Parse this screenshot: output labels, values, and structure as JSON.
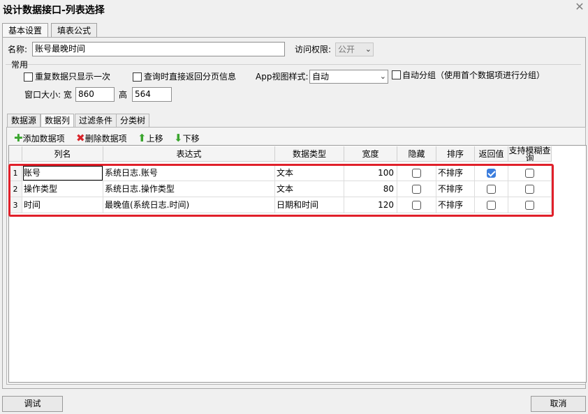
{
  "window": {
    "title": "设计数据接口-列表选择"
  },
  "tabs": [
    {
      "label": "基本设置"
    },
    {
      "label": "填表公式"
    }
  ],
  "form": {
    "name_label": "名称:",
    "name_value": "账号最晚时间",
    "access_label": "访问权限:",
    "access_value": "公开"
  },
  "common": {
    "group_label": "常用",
    "dedupe_label": "重复数据只显示一次",
    "paging_label": "查询时直接返回分页信息",
    "app_view_label": "App视图样式:",
    "app_view_value": "自动",
    "autogroup_label": "自动分组（使用首个数据项进行分组）",
    "window_size_label": "窗口大小: 宽",
    "width_value": "860",
    "height_label": "高",
    "height_value": "564"
  },
  "subtabs": [
    {
      "label": "数据源"
    },
    {
      "label": "数据列"
    },
    {
      "label": "过滤条件"
    },
    {
      "label": "分类树"
    }
  ],
  "toolbar": {
    "add_label": "添加数据项",
    "delete_label": "删除数据项",
    "up_label": "上移",
    "down_label": "下移"
  },
  "table": {
    "columns": [
      "列名",
      "表达式",
      "数据类型",
      "宽度",
      "隐藏",
      "排序",
      "返回值",
      "支持模糊查询"
    ],
    "rows": [
      {
        "index": "1",
        "name": "账号",
        "expr": "系统日志.账号",
        "type": "文本",
        "width": "100",
        "hidden": false,
        "sort": "不排序",
        "ret": true,
        "fuzzy": false
      },
      {
        "index": "2",
        "name": "操作类型",
        "expr": "系统日志.操作类型",
        "type": "文本",
        "width": "80",
        "hidden": false,
        "sort": "不排序",
        "ret": false,
        "fuzzy": false
      },
      {
        "index": "3",
        "name": "时间",
        "expr": "最晚值(系统日志.时间)",
        "type": "日期和时间",
        "width": "120",
        "hidden": false,
        "sort": "不排序",
        "ret": false,
        "fuzzy": false
      }
    ]
  },
  "footer": {
    "debug_label": "调试",
    "cancel_label": "取消"
  },
  "colors": {
    "highlight": "#e0202a",
    "check": "#3b7ddd"
  }
}
